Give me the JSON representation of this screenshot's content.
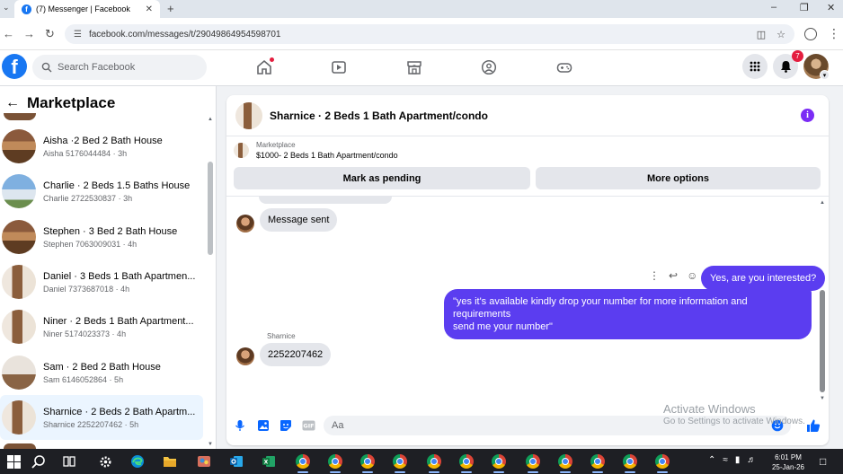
{
  "browser": {
    "tab_title": "(7) Messenger | Facebook",
    "url": "facebook.com/messages/t/29049864954598701"
  },
  "fb": {
    "search_placeholder": "Search Facebook",
    "notifications_count": "7",
    "brand_color": "#1877f2"
  },
  "sidebar": {
    "title": "Marketplace",
    "conversations": [
      {
        "name": "Aisha ·2 Bed 2 Bath House",
        "sub": "Aisha 5176044484 · 3h"
      },
      {
        "name": "Charlie · 2 Beds 1.5 Baths House",
        "sub": "Charlie 2722530837 · 3h"
      },
      {
        "name": "Stephen · 3 Bed 2 Bath House",
        "sub": "Stephen 7063009031 · 4h"
      },
      {
        "name": "Daniel · 3 Beds 1 Bath Apartmen...",
        "sub": "Daniel 7373687018 · 4h"
      },
      {
        "name": "Niner · 2 Beds 1 Bath Apartment...",
        "sub": "Niner 5174023373 · 4h"
      },
      {
        "name": "Sam · 2 Bed 2 Bath House",
        "sub": "Sam 6146052864 · 5h"
      },
      {
        "name": "Sharnice · 2 Beds 2 Bath Apartm...",
        "sub": "Sharnice 2252207462 · 5h"
      }
    ]
  },
  "chat": {
    "title": "Sharnice · 2 Beds 1 Bath Apartment/condo",
    "marketplace_label": "Marketplace",
    "listing": "$1000- 2 Beds 1 Bath Apartment/condo",
    "mark_pending": "Mark as pending",
    "more_options": "More options",
    "messages": {
      "m1": "Message sent",
      "m2": "Yes, are you interested?",
      "m3_line1": "\"yes it's available kindly drop your number for more information and requirements",
      "m3_line2": "send me your number\"",
      "sender": "Sharnice",
      "m4": "2252207462"
    },
    "composer_placeholder": "Aa",
    "accent_color": "#5b3df0"
  },
  "watermark": {
    "line1": "Activate Windows",
    "line2": "Go to Settings to activate Windows."
  },
  "taskbar": {
    "time": "6:01 PM",
    "date": "25-Jan-26"
  }
}
